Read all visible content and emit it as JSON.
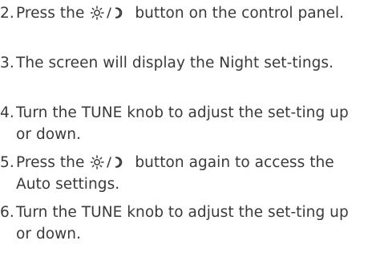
{
  "steps": [
    {
      "number": "2.",
      "before": "Press the",
      "icon": "sun-moon-icon",
      "after": "button on the control panel."
    },
    {
      "number": "3.",
      "text": "The screen will display the Night set-tings."
    },
    {
      "number": "4.",
      "text": "Turn the TUNE knob to adjust the set-ting up or down."
    },
    {
      "number": "5.",
      "before": "Press the",
      "icon": "sun-moon-icon",
      "after": "button again to access the Auto settings."
    },
    {
      "number": "6.",
      "text": "Turn the TUNE knob to adjust the set-ting up or down."
    }
  ],
  "colors": {
    "text": "#3a3a3a",
    "background": "#ffffff"
  }
}
